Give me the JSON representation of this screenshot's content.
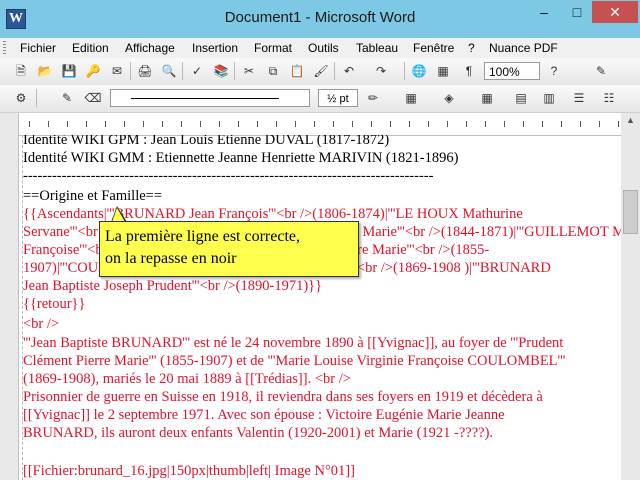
{
  "window": {
    "title": "Document1 - Microsoft Word"
  },
  "menu": {
    "fichier": "Fichier",
    "edition": "Edition",
    "affichage": "Affichage",
    "insertion": "Insertion",
    "format": "Format",
    "outils": "Outils",
    "tableau": "Tableau",
    "fenetre": "Fenêtre",
    "help": "?",
    "nuance": "Nuance PDF"
  },
  "toolbar": {
    "zoom": "100%",
    "line_width": "½ pt"
  },
  "document": {
    "lines": [
      "Identité WIKI GPM : Jean Louis Etienne DUVAL (1817-1872)",
      "Identité WIKI GMM : Etiennette Jeanne Henriette MARIVIN (1821-1896)",
      "-------------------------------------------------------------------------------------",
      "==Origine et Famille==",
      "{{Ascendants|'''BRUNARD Jean François'''<br />(1806-1874)|'''LE HOUX Mathurine",
      "Servane'''<br />(1819-1889)|'''BRUNARD Clément Pierre Marie'''<br />(1844-1871)|'''GUILLEMOT Marie",
      "Françoise'''<br />(1853-1933)|'''BRUNARD Clément Pierre Marie'''<br />(1855-",
      "1907)|'''COULOMBEL Marie Louise Virginie Françoise'''<br />(1869-1908 )|'''BRUNARD",
      "Jean Baptiste Joseph Prudent'''<br />(1890-1971)}}",
      "{{retour}}",
      "<br />",
      "'''Jean Baptiste BRUNARD''' est né le 24 novembre 1890 à [[Yvignac]], au foyer de '''Prudent",
      "Clément Pierre Marie''' (1855-1907) et de '''Marie Louise Virginie Françoise COULOMBEL'''",
      "(1869-1908), mariés le 20 mai 1889 à [[Trédias]]. <br />",
      "Prisonnier de guerre en Suisse en 1918, il reviendra dans ses foyers en 1919 et décèdera à",
      "[[Yvignac]] le 2 septembre 1971. Avec son épouse : Victoire Eugénie Marie Jeanne",
      "BRUNARD, ils auront deux enfants Valentin (1920-2001) et Marie (1921 -????).",
      "[[Fichier:brunard_16.jpg|150px|thumb|left| Image N°01]]"
    ]
  },
  "callout": {
    "line1": "La première ligne est correcte,",
    "line2": "on la repasse en noir"
  },
  "colors": {
    "titlebar": "#7dc8e4",
    "wiki_text": "#e4122b",
    "callout": "#ffff4d"
  }
}
